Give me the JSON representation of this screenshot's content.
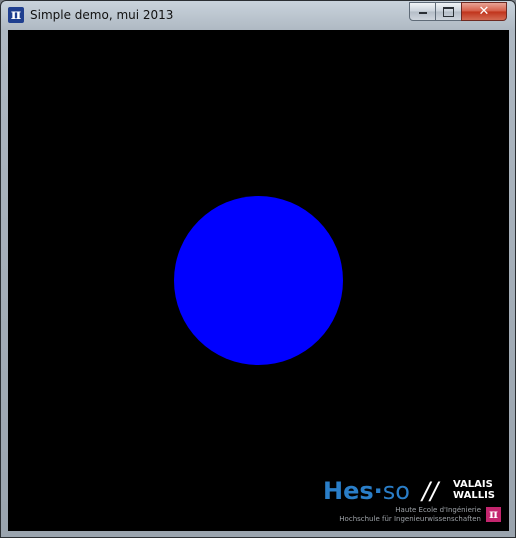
{
  "window": {
    "title": "Simple demo, mui 2013",
    "app_icon_glyph": "π",
    "controls": {
      "minimize_icon": "minimize-icon",
      "maximize_icon": "maximize-icon",
      "close_glyph": "✕"
    }
  },
  "canvas": {
    "background_color": "#000000",
    "shape": {
      "kind": "circle",
      "color": "#0000ff"
    }
  },
  "logo": {
    "brand_hes": "Hes",
    "brand_dot": "·",
    "brand_so": "so",
    "brand_slashes": "//",
    "region_line1": "VALAIS",
    "region_line2": "WALLIS",
    "subtitle_fr": "Haute Ecole d'Ingénierie",
    "subtitle_de": "Hochschule für Ingenieurwissenschaften",
    "pi_glyph": "π",
    "brand_color": "#2a7ec8",
    "pi_color": "#c4266e"
  }
}
